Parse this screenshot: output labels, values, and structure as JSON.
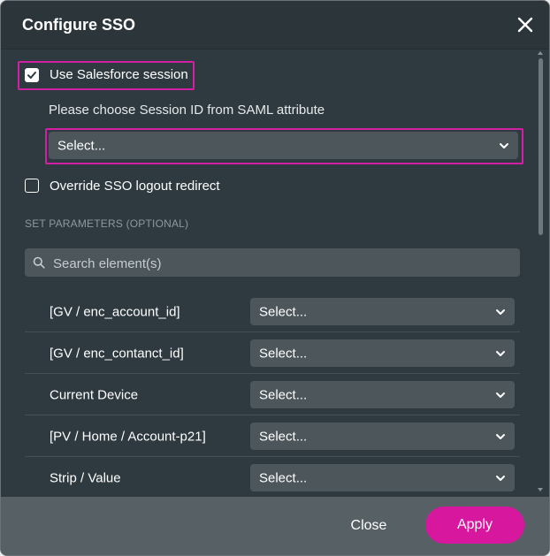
{
  "dialog": {
    "title": "Configure SSO",
    "close_icon": "close-icon"
  },
  "session": {
    "use_salesforce_label": "Use Salesforce session",
    "use_salesforce_checked": true,
    "session_id_hint": "Please choose Session ID from SAML attribute",
    "session_id_select": "Select...",
    "override_logout_label": "Override SSO logout redirect",
    "override_logout_checked": false
  },
  "parameters": {
    "section_title": "SET PARAMETERS (OPTIONAL)",
    "search_placeholder": "Search element(s)",
    "rows": [
      {
        "label": "[GV / enc_account_id]",
        "value": "Select..."
      },
      {
        "label": "[GV / enc_contanct_id]",
        "value": "Select..."
      },
      {
        "label": "Current Device",
        "value": "Select..."
      },
      {
        "label": "[PV / Home / Account-p21]",
        "value": "Select..."
      },
      {
        "label": "Strip / Value",
        "value": "Select..."
      }
    ]
  },
  "footer": {
    "close_label": "Close",
    "apply_label": "Apply"
  },
  "colors": {
    "accent": "#d7189f",
    "highlight": "#d21fa3",
    "dialog_bg": "#2f3a40",
    "footer_bg": "#566065"
  }
}
